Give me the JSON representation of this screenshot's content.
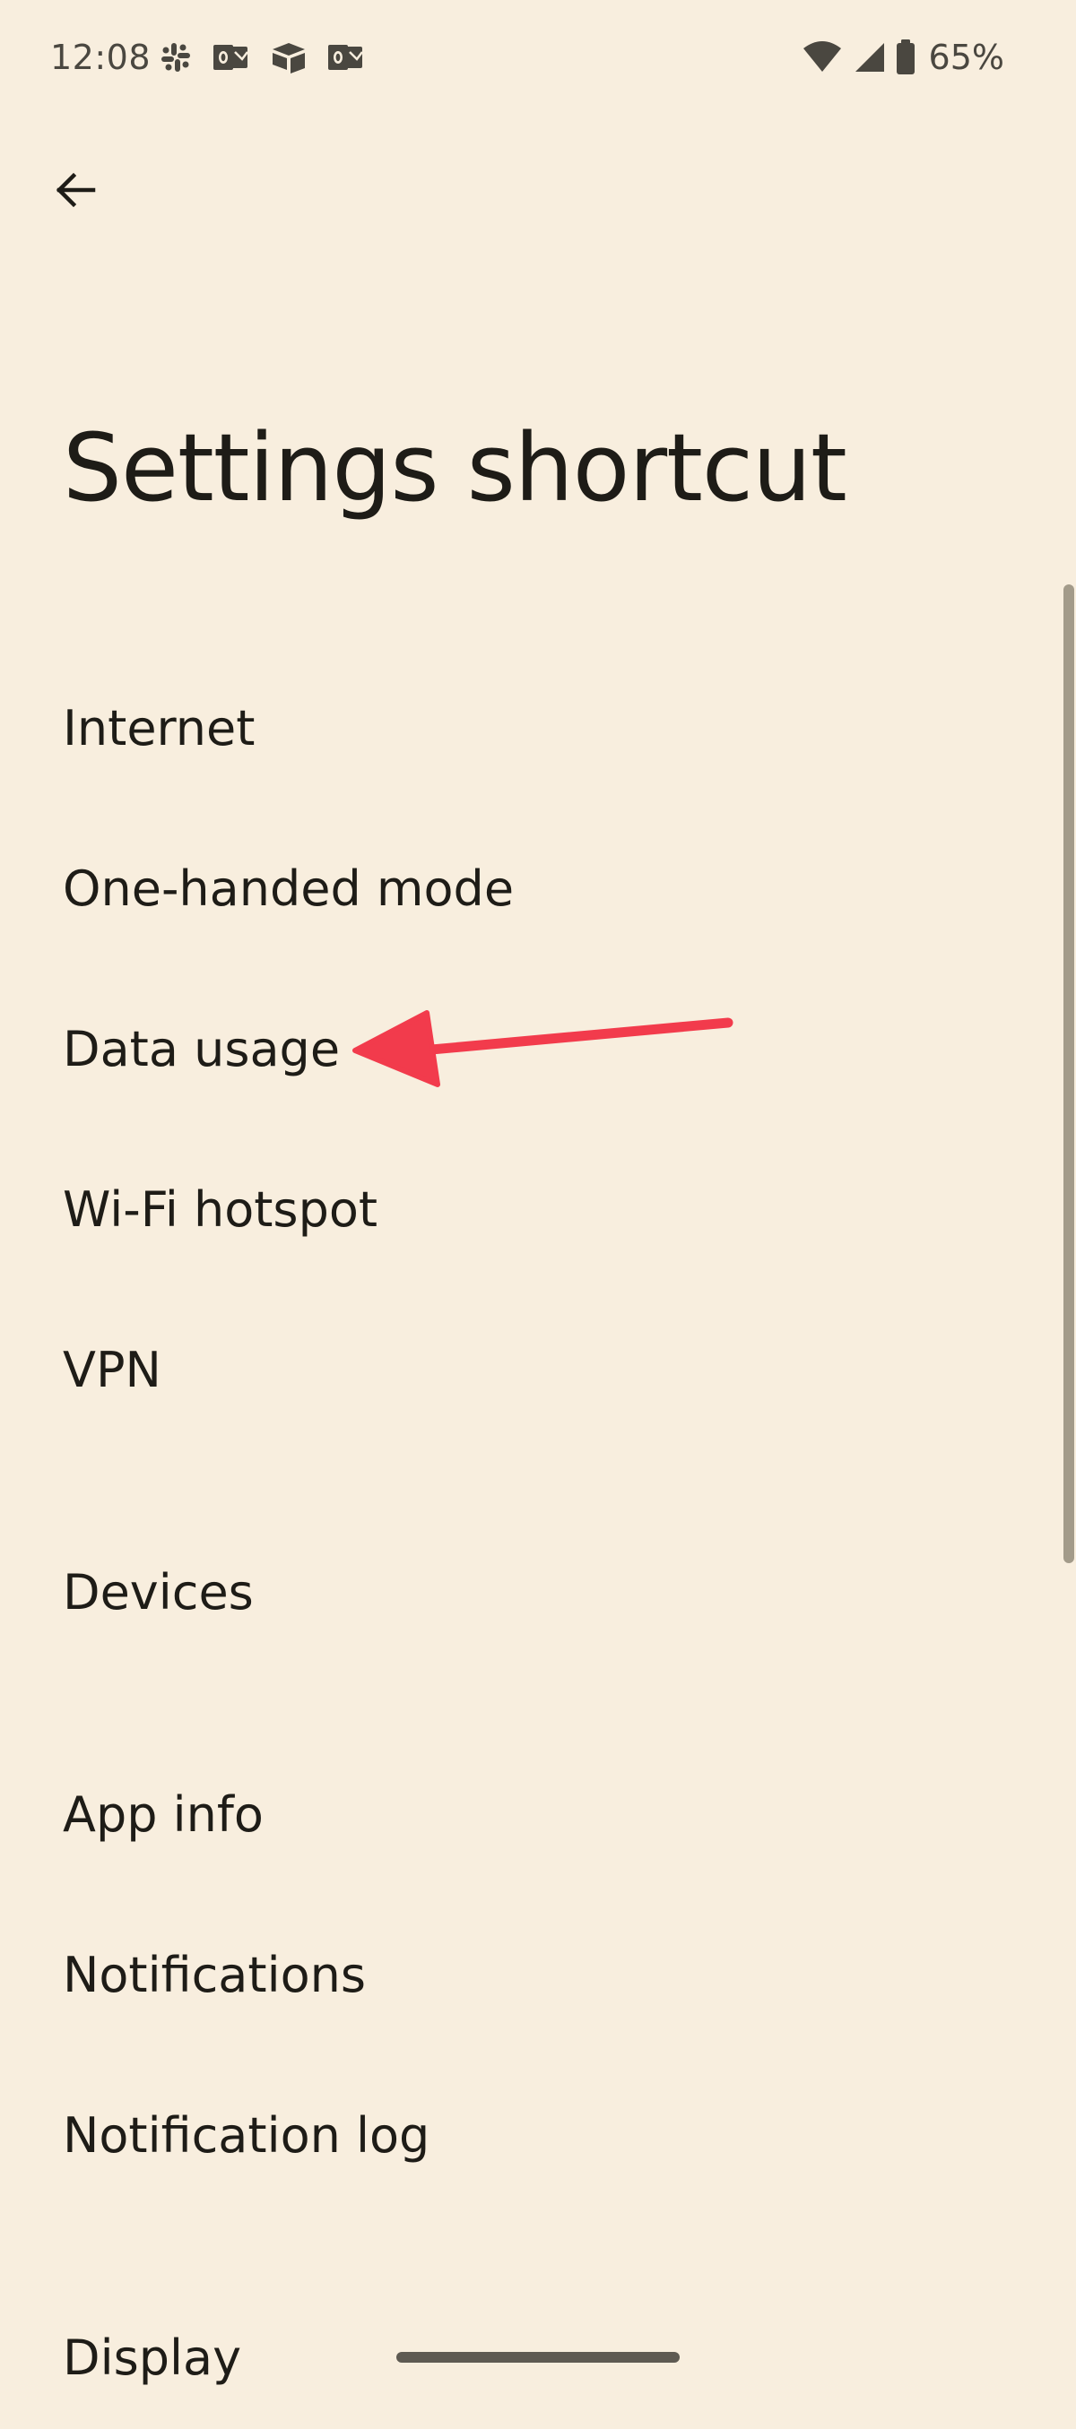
{
  "status_bar": {
    "time": "12:08",
    "notification_icons": [
      "slack-icon",
      "outlook-icon",
      "airtable-icon",
      "outlook-icon"
    ],
    "system_icons": [
      "wifi-icon",
      "cellular-signal-icon",
      "battery-icon"
    ],
    "battery_percent": "65%"
  },
  "header": {
    "back_icon": "arrow-back-icon",
    "title": "Settings shortcut"
  },
  "shortcuts": [
    {
      "label": "Internet"
    },
    {
      "label": "One-handed mode"
    },
    {
      "label": "Data usage"
    },
    {
      "label": "Wi-Fi hotspot"
    },
    {
      "label": "VPN"
    },
    {
      "label": "Devices"
    },
    {
      "label": "App info"
    },
    {
      "label": "Notifications"
    },
    {
      "label": "Notification log"
    },
    {
      "label": "Display"
    }
  ],
  "annotation": {
    "type": "arrow",
    "points_to": "Data usage",
    "color": "#F23B4C"
  },
  "colors": {
    "background": "#F8EEDE",
    "text": "#1E1C17",
    "status_text": "#4A4740",
    "scrollbar": "#A39B8A"
  }
}
